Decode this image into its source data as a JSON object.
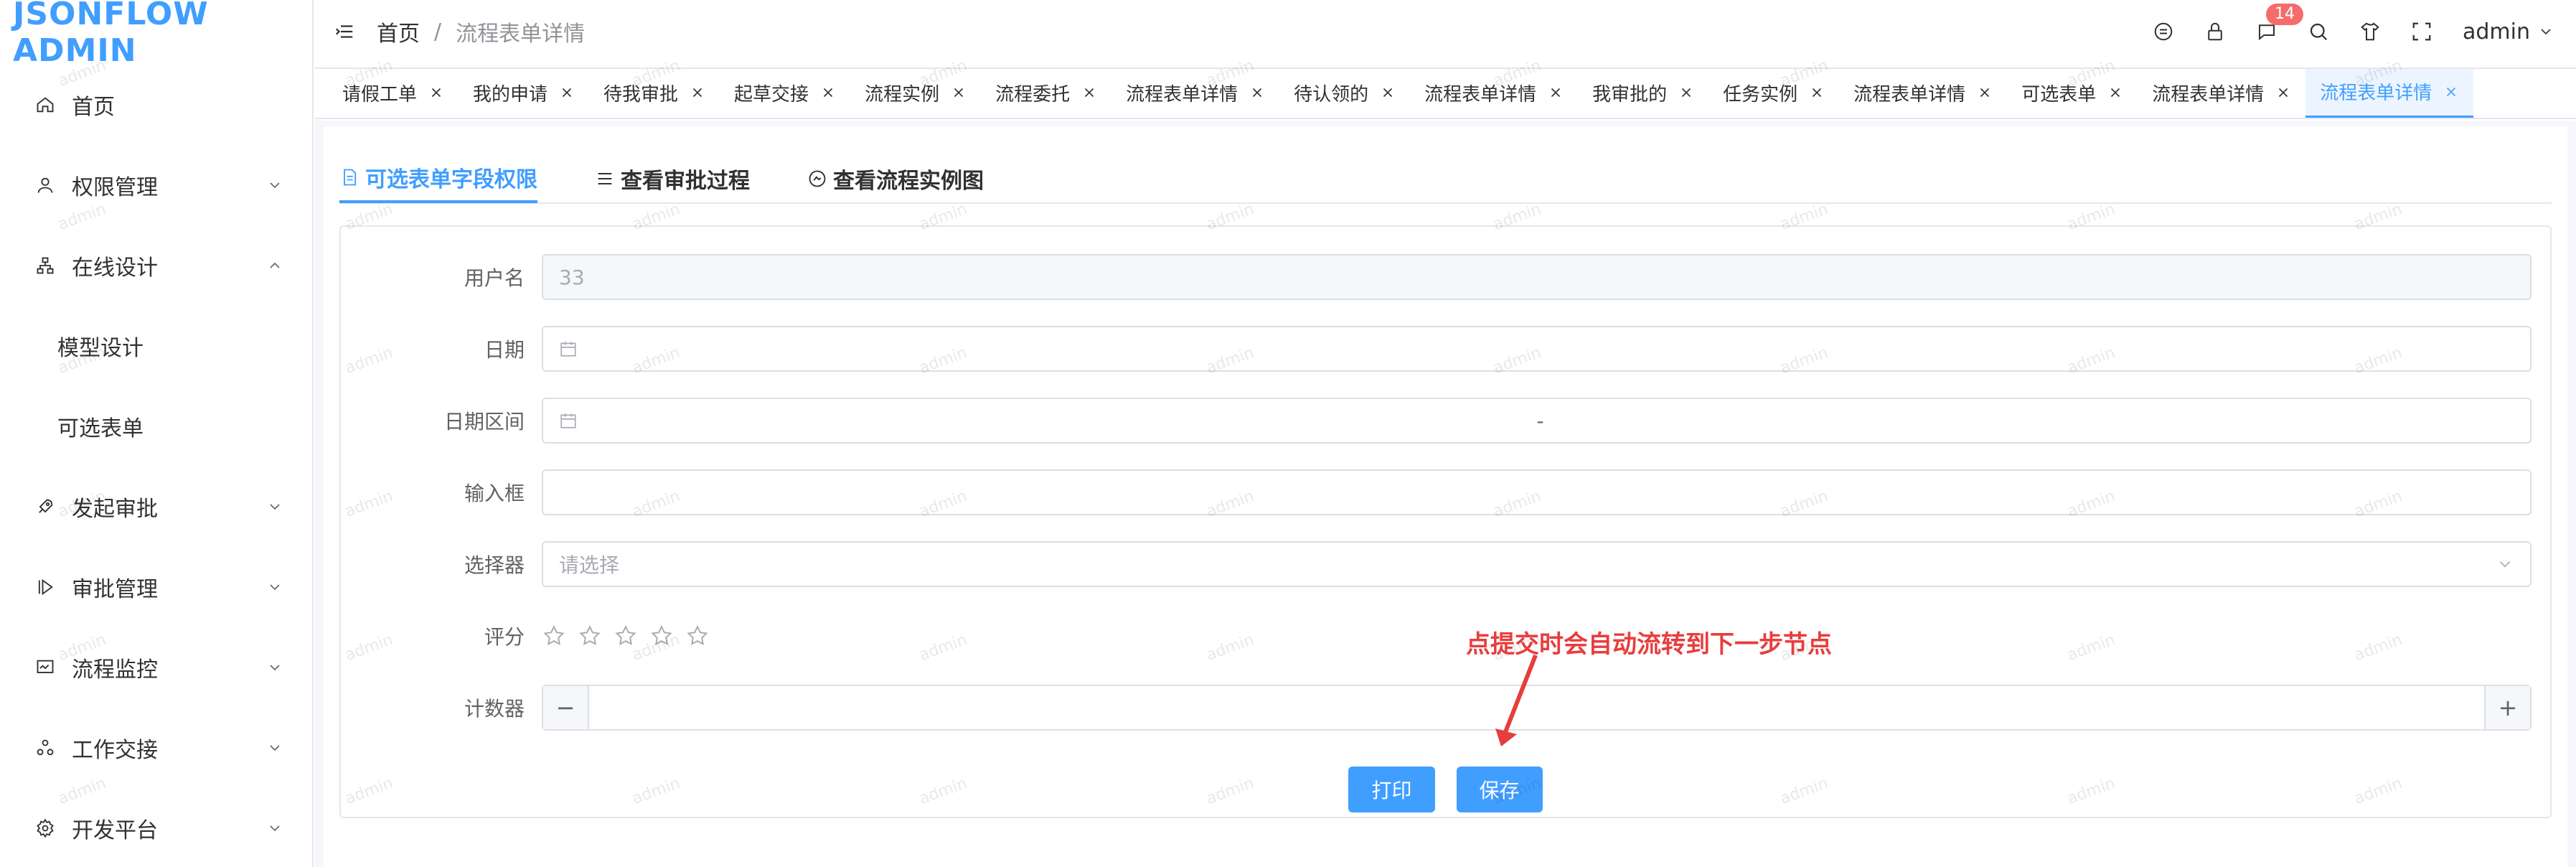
{
  "app": {
    "title": "JSONFLOW ADMIN"
  },
  "sidebar": {
    "items": [
      {
        "label": "首页",
        "icon": "home-icon"
      },
      {
        "label": "权限管理",
        "icon": "user-icon"
      },
      {
        "label": "在线设计",
        "icon": "org-icon"
      },
      {
        "label": "模型设计"
      },
      {
        "label": "可选表单"
      },
      {
        "label": "发起审批",
        "icon": "rocket-icon"
      },
      {
        "label": "审批管理",
        "icon": "play-icon"
      },
      {
        "label": "流程监控",
        "icon": "monitor-icon"
      },
      {
        "label": "工作交接",
        "icon": "handover-icon"
      },
      {
        "label": "开发平台",
        "icon": "gear-icon"
      }
    ]
  },
  "header": {
    "breadcrumb": {
      "home": "首页",
      "separator": "/",
      "current": "流程表单详情"
    },
    "badge_count": "14",
    "user": "admin"
  },
  "tags": [
    "请假工单",
    "我的申请",
    "待我审批",
    "起草交接",
    "流程实例",
    "流程委托",
    "流程表单详情",
    "待认领的",
    "流程表单详情",
    "我审批的",
    "任务实例",
    "流程表单详情",
    "可选表单",
    "流程表单详情",
    "流程表单详情"
  ],
  "tabs": [
    {
      "label": "可选表单字段权限"
    },
    {
      "label": "查看审批过程"
    },
    {
      "label": "查看流程实例图"
    }
  ],
  "form": {
    "username": {
      "label": "用户名",
      "value": "33"
    },
    "date": {
      "label": "日期"
    },
    "date_range": {
      "label": "日期区间",
      "separator": "-"
    },
    "input": {
      "label": "输入框"
    },
    "select": {
      "label": "选择器",
      "placeholder": "请选择"
    },
    "rate": {
      "label": "评分",
      "value": 0,
      "max": 5
    },
    "counter": {
      "label": "计数器",
      "minus": "−",
      "plus": "+"
    }
  },
  "actions": {
    "print": "打印",
    "save": "保存"
  },
  "annotation": "点提交时会自动流转到下一步节点",
  "watermark": "admin",
  "colors": {
    "primary": "#409eff",
    "annotation": "#e83d3d",
    "badge": "#f56c6c"
  }
}
